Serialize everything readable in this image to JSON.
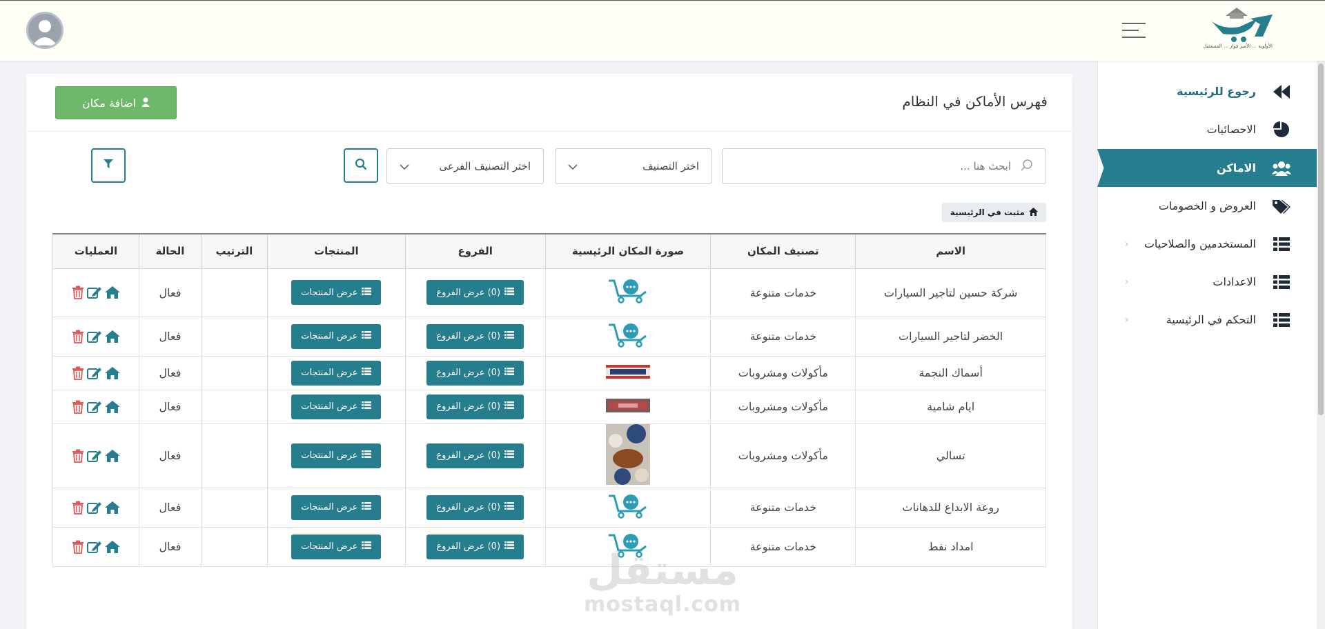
{
  "header": {
    "logo_tagline": "الأولوية ... الأمير فواز ... المستقبل"
  },
  "sidebar": {
    "items": [
      {
        "label": "رجوع للرئيسية"
      },
      {
        "label": "الاحصائيات"
      },
      {
        "label": "الاماكن"
      },
      {
        "label": "العروض و الخصومات"
      },
      {
        "label": "المستخدمين والصلاحيات"
      },
      {
        "label": "الاعدادات"
      },
      {
        "label": "التحكم في الرئيسية"
      }
    ]
  },
  "main": {
    "title": "فهرس الأماكن في النظام",
    "add_button": "اضافة مكان",
    "search_placeholder": "ابحث هنا ...",
    "category_select": "اختر التصنيف",
    "subcategory_select": "اختر التصنيف الفرعى",
    "pinned_badge": "مثبت في الرئيسية"
  },
  "table": {
    "columns": [
      "الاسم",
      "تصنيف المكان",
      "صورة المكان الرئيسية",
      "الفروع",
      "المنتجات",
      "الترتيب",
      "الحالة",
      "العمليات"
    ],
    "rows": [
      {
        "name": "شركة حسين لتاجير السيارات",
        "category": "خدمات متنوعة",
        "branches": "(0) عرض الفروع",
        "products": "عرض المنتجات",
        "order": "",
        "status": "فعال"
      },
      {
        "name": "الخضر لتاجير السيارات",
        "category": "خدمات متنوعة",
        "branches": "(0) عرض الفروع",
        "products": "عرض المنتجات",
        "order": "",
        "status": "فعال"
      },
      {
        "name": "أسماك النجمة",
        "category": "مأكولات ومشروبات",
        "branches": "(0) عرض الفروع",
        "products": "عرض المنتجات",
        "order": "",
        "status": "فعال"
      },
      {
        "name": "ايام شامية",
        "category": "مأكولات ومشروبات",
        "branches": "(0) عرض الفروع",
        "products": "عرض المنتجات",
        "order": "",
        "status": "فعال"
      },
      {
        "name": "تسالي",
        "category": "مأكولات ومشروبات",
        "branches": "(0) عرض الفروع",
        "products": "عرض المنتجات",
        "order": "",
        "status": "فعال"
      },
      {
        "name": "روعة الابداع للدهانات",
        "category": "خدمات متنوعة",
        "branches": "(0) عرض الفروع",
        "products": "عرض المنتجات",
        "order": "",
        "status": "فعال"
      },
      {
        "name": "امداد نفط",
        "category": "خدمات متنوعة",
        "branches": "(0) عرض الفروع",
        "products": "عرض المنتجات",
        "order": "",
        "status": "فعال"
      }
    ]
  },
  "watermark": {
    "arabic": "مستقل",
    "latin": "mostaql.com"
  },
  "colors": {
    "accent": "#257d8e",
    "add_button": "#6fb76b",
    "delete": "#e05555"
  }
}
